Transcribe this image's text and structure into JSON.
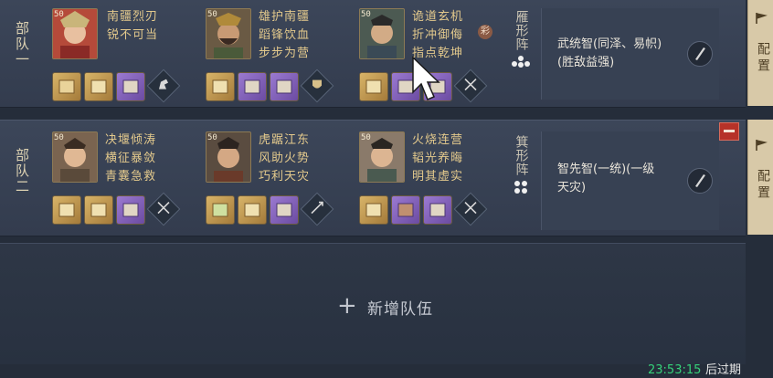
{
  "teams": [
    {
      "label": "部队一",
      "generals": [
        {
          "level": "50",
          "skills": [
            "南疆烈刃",
            "锐不可当"
          ]
        },
        {
          "level": "50",
          "skills": [
            "雄护南疆",
            "蹈锋饮血",
            "步步为营"
          ]
        },
        {
          "level": "50",
          "skills": [
            "诡道玄机",
            "折冲御侮",
            "指点乾坤"
          ]
        }
      ],
      "formation": "雁形阵",
      "tactic": [
        "武统智(同泽、易帜)",
        "(胜敌益强)"
      ],
      "config_label": "配置"
    },
    {
      "label": "部队二",
      "generals": [
        {
          "level": "50",
          "skills": [
            "决堰倾涛",
            "横征暴敛",
            "青囊急救"
          ]
        },
        {
          "level": "50",
          "skills": [
            "虎踞江东",
            "风助火势",
            "巧利天灾"
          ]
        },
        {
          "level": "50",
          "skills": [
            "火烧连营",
            "韬光养晦",
            "明其虚实"
          ]
        }
      ],
      "formation": "箕形阵",
      "tactic": [
        "智先智(一统)(一级",
        "天灾)"
      ],
      "config_label": "配置"
    }
  ],
  "chip_label": "彩",
  "add_team_label": "新增队伍",
  "footer": {
    "time": "23:53:15",
    "suffix": "后过期"
  },
  "colors": {
    "accent_gold": "#e3c98c",
    "time_green": "#36d27a",
    "config_bg": "#d8c9a8"
  }
}
